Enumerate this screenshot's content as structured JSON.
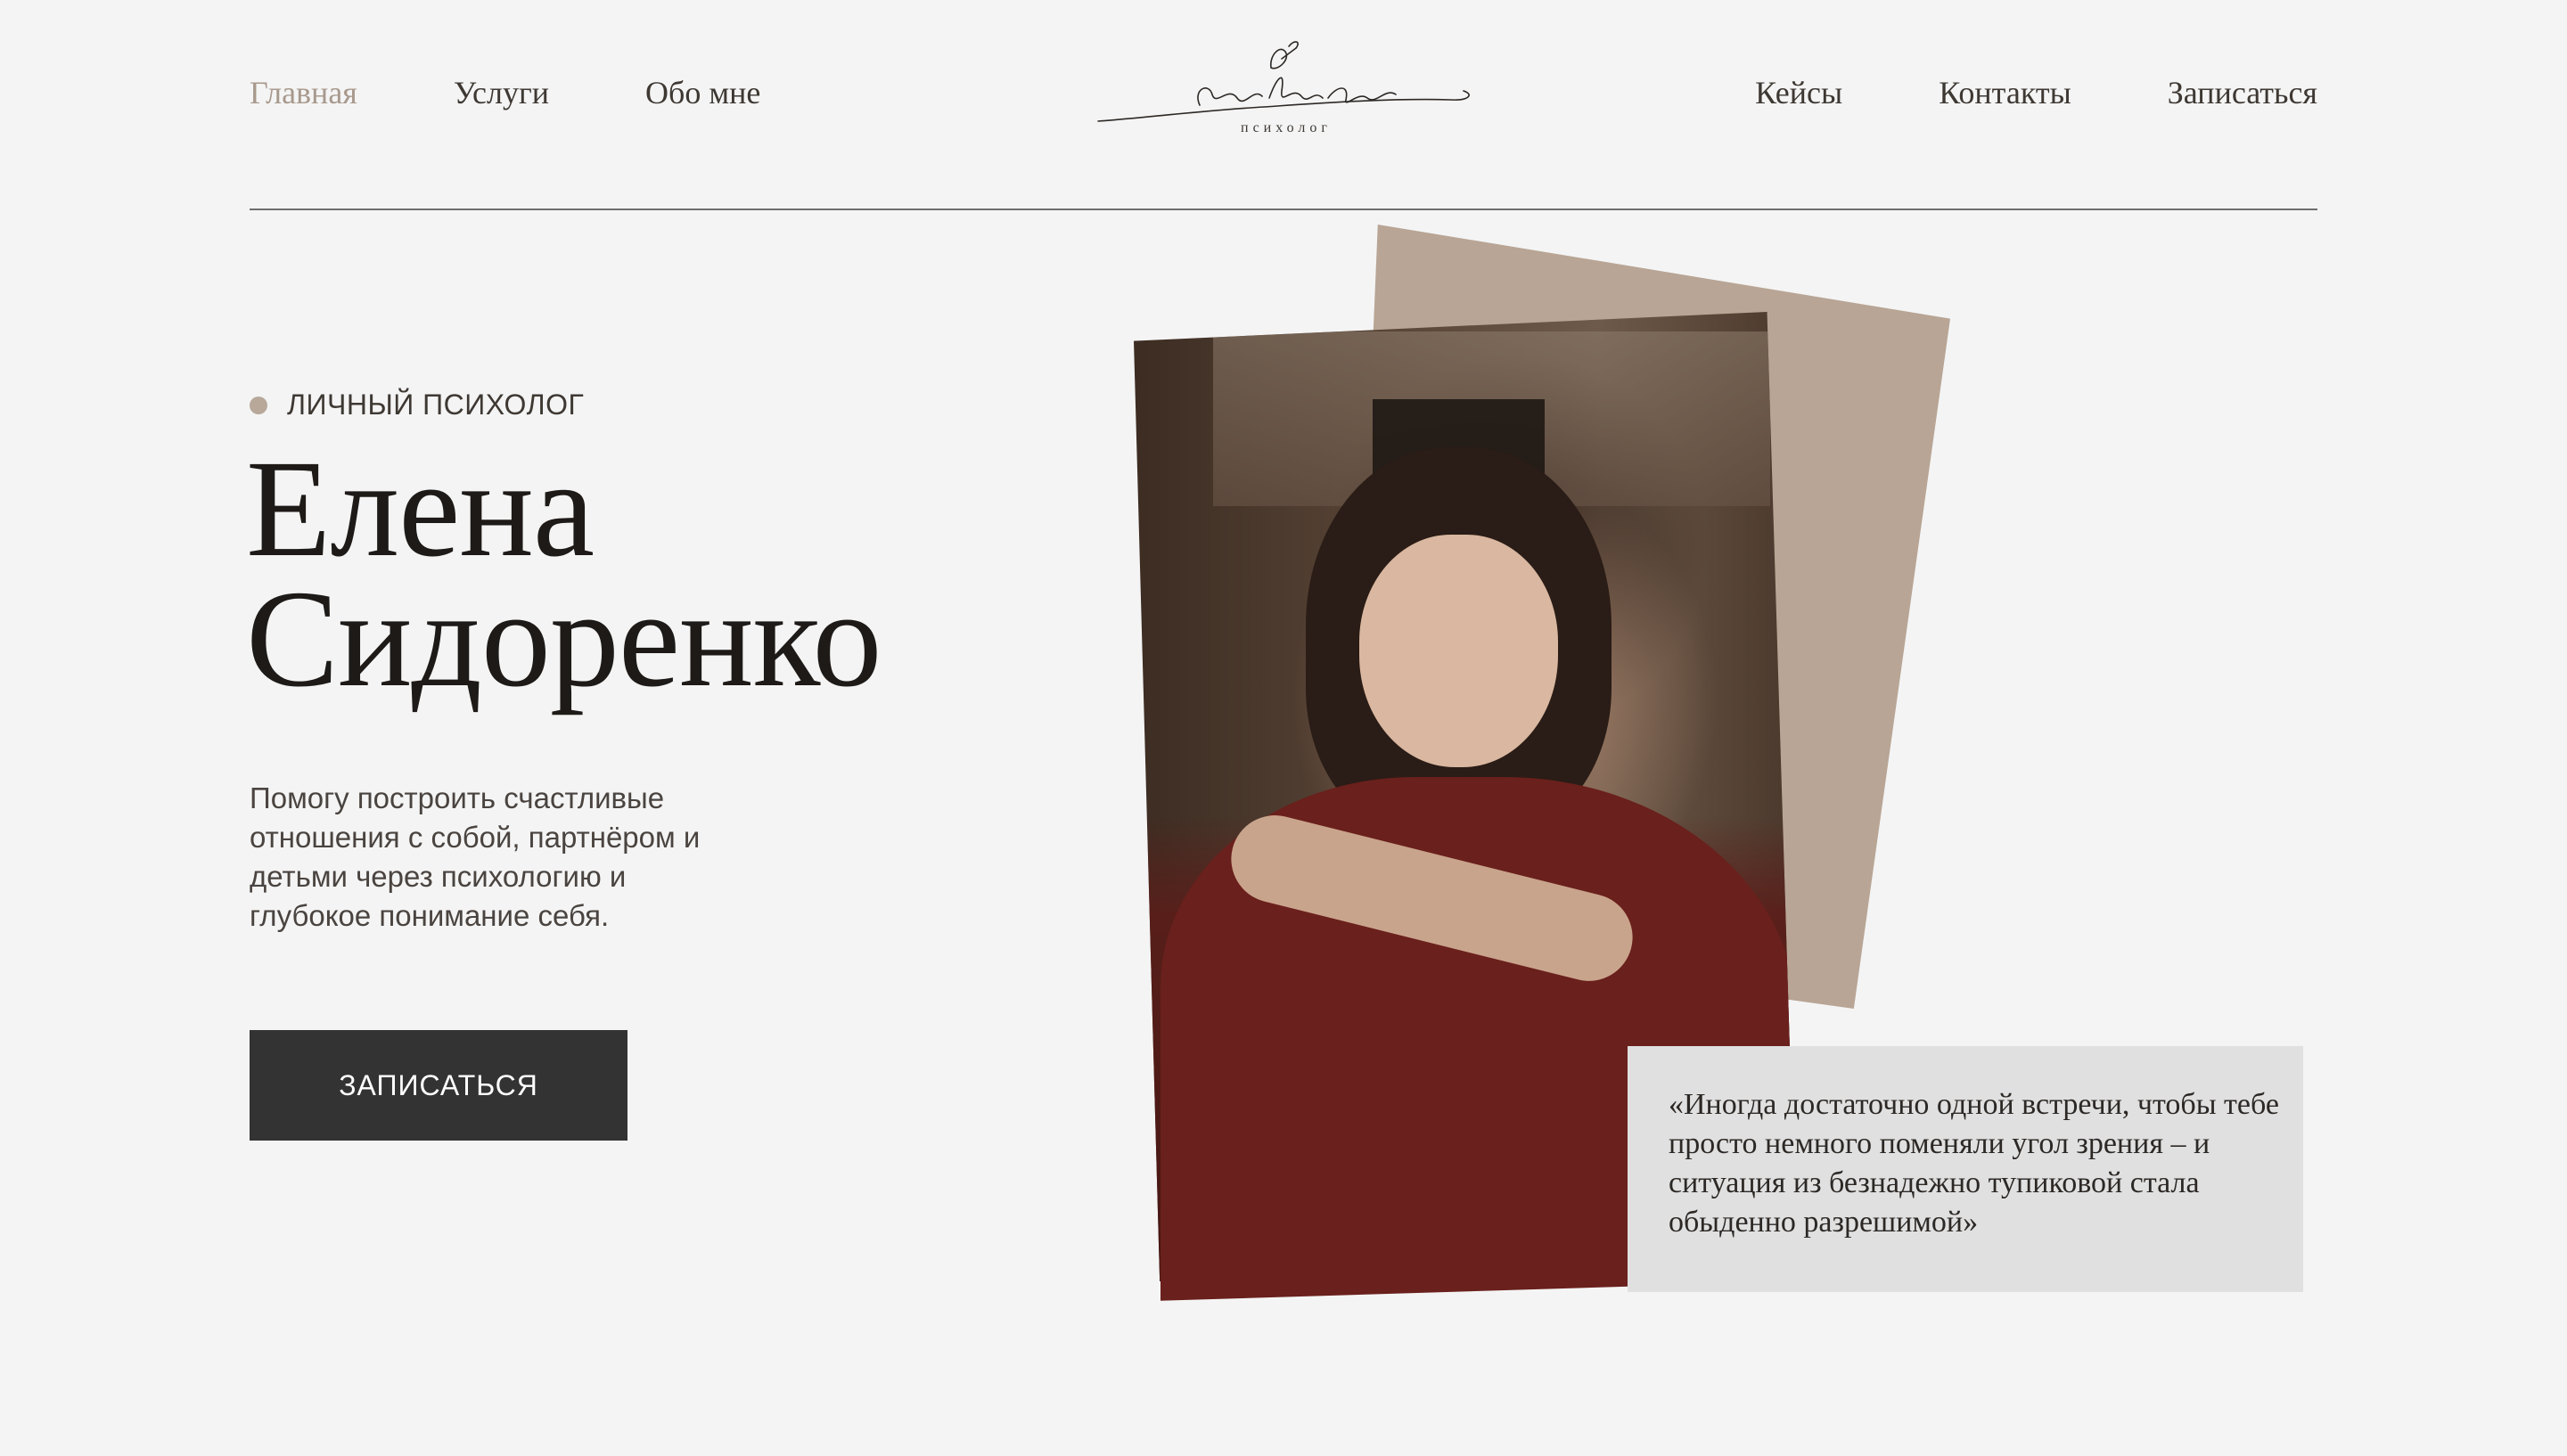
{
  "nav": {
    "left": [
      {
        "label": "Главная",
        "active": true
      },
      {
        "label": "Услуги",
        "active": false
      },
      {
        "label": "Обо мне",
        "active": false
      }
    ],
    "right": [
      {
        "label": "Кейсы"
      },
      {
        "label": "Контакты"
      },
      {
        "label": "Записаться"
      }
    ]
  },
  "logo": {
    "subtitle": "психолог"
  },
  "hero": {
    "eyebrow": "ЛИЧНЫЙ ПСИХОЛОГ",
    "name_first": "Елена",
    "name_last": "Сидоренко",
    "description": "Помогу построить счастливые отношения с собой, партнёром и детьми через психологию и глубокое понимание себя.",
    "cta_label": "ЗАПИСАТЬСЯ"
  },
  "quote": {
    "text": "«Иногда достаточно одной встречи, чтобы тебе просто немного поменяли угол зрения – и ситуация из безнадежно тупиковой стала обыденно разрешимой»"
  },
  "colors": {
    "background": "#f4f4f4",
    "accent": "#b8a595",
    "nav_active": "#a8998d",
    "button": "#333333",
    "quote_bg": "#e0e0e0",
    "text_dark": "#1e1a17"
  }
}
